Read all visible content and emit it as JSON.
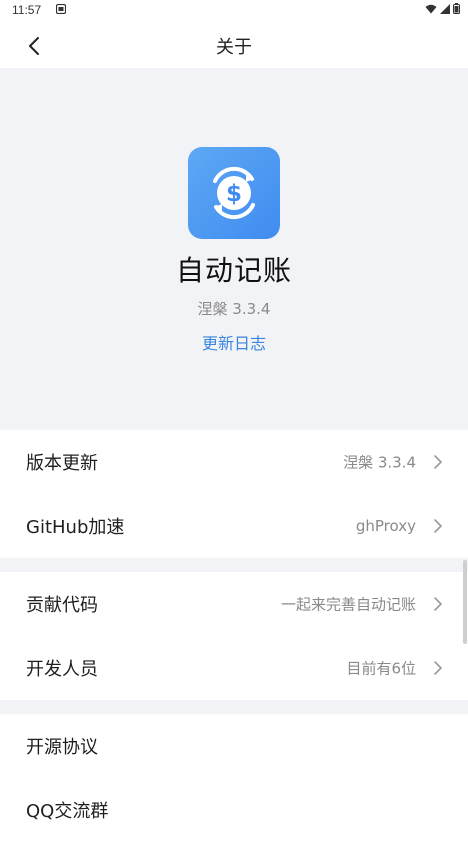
{
  "status_bar": {
    "time": "11:57",
    "icons": [
      "notification-icon",
      "wifi-icon",
      "signal-icon",
      "battery-icon"
    ]
  },
  "app_bar": {
    "back_icon": "back-arrow-icon",
    "title": "关于"
  },
  "hero": {
    "icon": "dollar-refresh-icon",
    "app_name": "自动记账",
    "version": "涅槃 3.3.4",
    "changelog_link": "更新日志"
  },
  "groups": [
    {
      "rows": [
        {
          "label": "版本更新",
          "value": "涅槃 3.3.4"
        },
        {
          "label": "GitHub加速",
          "value": "ghProxy"
        }
      ]
    },
    {
      "rows": [
        {
          "label": "贡献代码",
          "value": "一起来完善自动记账"
        },
        {
          "label": "开发人员",
          "value": "目前有6位"
        }
      ]
    },
    {
      "rows": [
        {
          "label": "开源协议",
          "value": ""
        },
        {
          "label": "QQ交流群",
          "value": ""
        }
      ]
    }
  ],
  "colors": {
    "accent": "#3a86df",
    "background_gray": "#f2f3f6",
    "icon_blue": "#4a97f2"
  }
}
